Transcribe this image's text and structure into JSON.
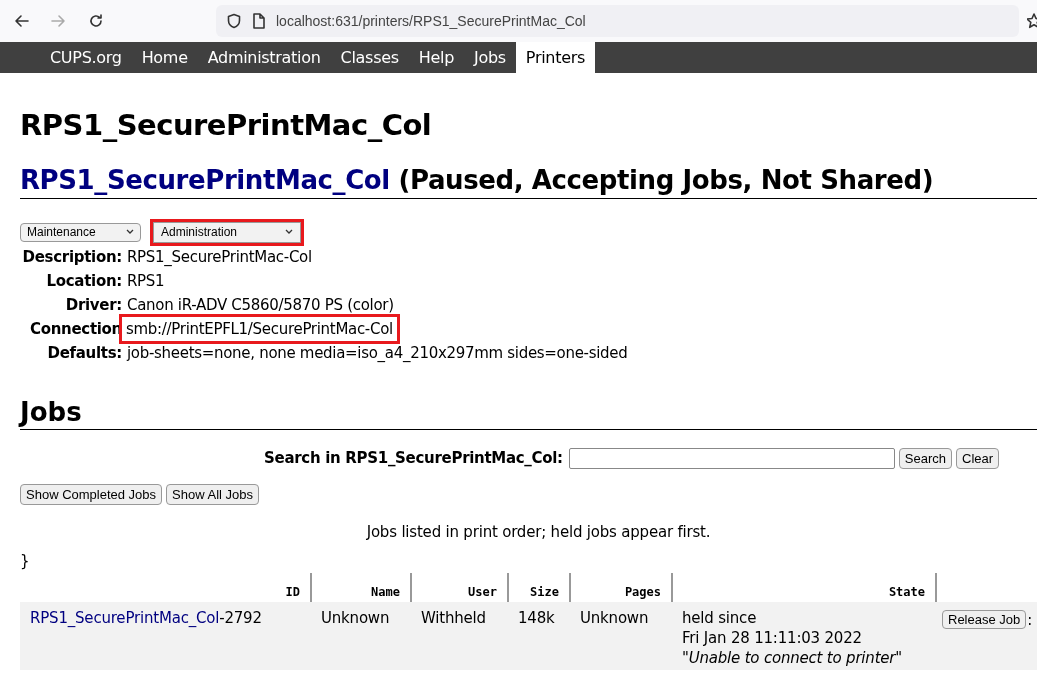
{
  "browser": {
    "url": "localhost:631/printers/RPS1_SecurePrintMac_Col"
  },
  "nav": [
    {
      "label": "CUPS.org",
      "selected": false
    },
    {
      "label": "Home",
      "selected": false
    },
    {
      "label": "Administration",
      "selected": false
    },
    {
      "label": "Classes",
      "selected": false
    },
    {
      "label": "Help",
      "selected": false
    },
    {
      "label": "Jobs",
      "selected": false
    },
    {
      "label": "Printers",
      "selected": true
    }
  ],
  "page_title": "RPS1_SecurePrintMac_Col",
  "printer": {
    "name_link": "RPS1_SecurePrintMac_Col",
    "status": "(Paused, Accepting Jobs, Not Shared)"
  },
  "actions": [
    {
      "value": "Maintenance",
      "highlighted": false
    },
    {
      "value": "Administration",
      "highlighted": true
    }
  ],
  "details": [
    {
      "label": "Description:",
      "value": "RPS1_SecurePrintMac-Col",
      "highlighted": false
    },
    {
      "label": "Location:",
      "value": "RPS1",
      "highlighted": false
    },
    {
      "label": "Driver:",
      "value": "Canon iR-ADV C5860/5870 PS (color)",
      "highlighted": false
    },
    {
      "label": "Connection",
      "value": "smb://PrintEPFL1/SecurePrintMac-Col",
      "highlighted": true
    },
    {
      "label": "Defaults:",
      "value": "job-sheets=none, none media=iso_a4_210x297mm sides=one-sided",
      "highlighted": false
    }
  ],
  "jobs": {
    "heading": "Jobs",
    "search_label": "Search in RPS1_SecurePrintMac_Col:",
    "search_button": "Search",
    "clear_button": "Clear",
    "buttons": [
      "Show Completed Jobs",
      "Show All Jobs"
    ],
    "note": "Jobs listed in print order; held jobs appear first.",
    "stray_text": "}",
    "columns": [
      "ID",
      "Name",
      "User",
      "Size",
      "Pages",
      "State"
    ],
    "rows": [
      {
        "id_link": "RPS1_SecurePrintMac_Col",
        "id_suffix": "-2792",
        "name": "Unknown",
        "user": "Withheld",
        "size": "148k",
        "pages": "Unknown",
        "state": "held since",
        "state_time": "Fri Jan 28 11:11:03 2022",
        "state_message": "\"Unable to connect to printer\"",
        "action": "Release Job",
        "trailing": ":"
      }
    ]
  }
}
